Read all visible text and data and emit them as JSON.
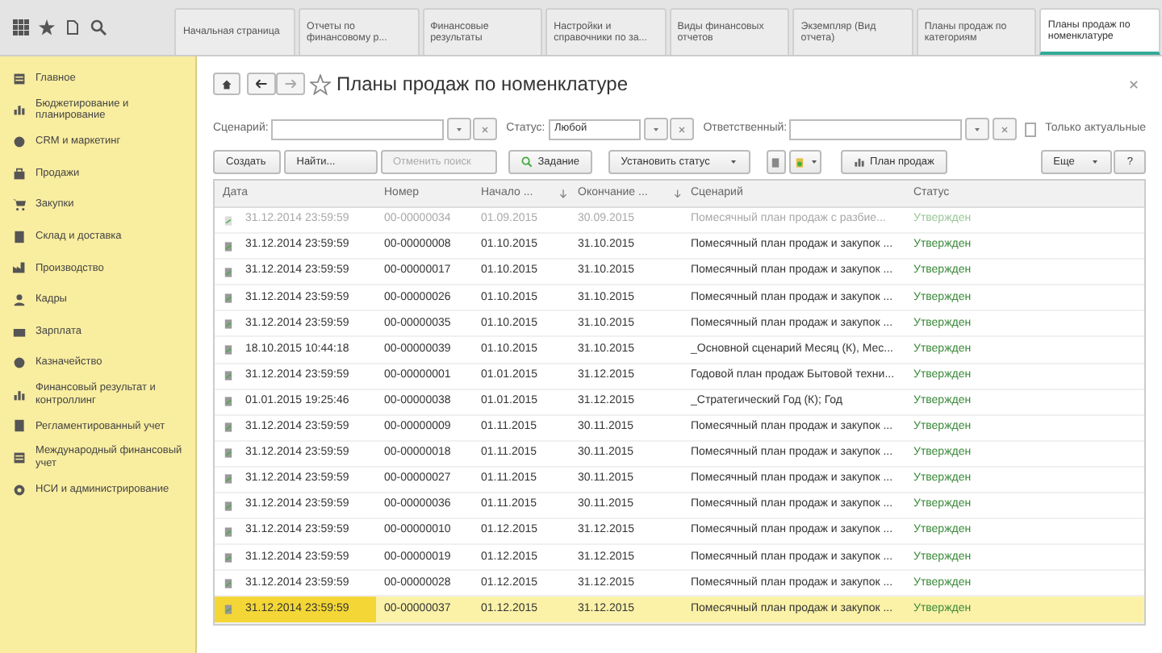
{
  "top_tabs": [
    {
      "label": "Начальная страница",
      "selected": false
    },
    {
      "label": "Отчеты по финансовому р...",
      "selected": false
    },
    {
      "label": "Финансовые результаты",
      "selected": false
    },
    {
      "label": "Настройки и справочники по за...",
      "selected": false
    },
    {
      "label": "Виды финансовых отчетов",
      "selected": false
    },
    {
      "label": "Экземпляр (Вид отчета)",
      "selected": false
    },
    {
      "label": "Планы продаж по категориям",
      "selected": false
    },
    {
      "label": "Планы продаж по номенклатуре",
      "selected": true
    }
  ],
  "sidebar": {
    "items": [
      {
        "label": "Главное"
      },
      {
        "label": "Бюджетирование и планирование"
      },
      {
        "label": "CRM и маркетинг"
      },
      {
        "label": "Продажи"
      },
      {
        "label": "Закупки"
      },
      {
        "label": "Склад и доставка"
      },
      {
        "label": "Производство"
      },
      {
        "label": "Кадры"
      },
      {
        "label": "Зарплата"
      },
      {
        "label": "Казначейство"
      },
      {
        "label": "Финансовый результат и контроллинг"
      },
      {
        "label": "Регламентированный учет"
      },
      {
        "label": "Международный финансовый учет"
      },
      {
        "label": "НСИ и администрирование"
      }
    ]
  },
  "form": {
    "title": "Планы продаж по номенклатуре",
    "filters": [
      {
        "label": "Сценарий:"
      },
      {
        "label": "Статус:",
        "value": "Любой"
      },
      {
        "label": "Ответственный:"
      }
    ],
    "only_actual": {
      "label": "Только актуальные",
      "checked": false
    },
    "toolbar": [
      {
        "label": "Создать",
        "kind": "plain",
        "disabled": false
      },
      {
        "label": "Найти...",
        "kind": "plain",
        "disabled": false
      },
      {
        "label": "Отменить поиск",
        "kind": "plain",
        "disabled": true
      },
      {
        "label": "Задание",
        "kind": "task",
        "disabled": false
      },
      {
        "label": "Установить статус",
        "kind": "dropdown",
        "disabled": false
      },
      {
        "kind": "doc-icon",
        "disabled": false
      },
      {
        "kind": "report-icon",
        "disabled": false
      },
      {
        "label": "План продаж",
        "kind": "plan",
        "disabled": false
      },
      {
        "label": "Еще",
        "kind": "dropdown",
        "disabled": false
      },
      {
        "label": "?",
        "kind": "plain",
        "disabled": false
      }
    ],
    "table": {
      "columns": [
        "Дата",
        "Номер",
        "Начало ...",
        "Окончание ...",
        "Сценарий",
        "Статус"
      ],
      "rows": [
        {
          "cells": [
            "31.12.2014 23:59:59",
            "00-00000034",
            "01.09.2015",
            "30.09.2015",
            "Помесячный план продаж с разбие...",
            "Утвержден"
          ],
          "faded": true,
          "selected": false
        },
        {
          "cells": [
            "31.12.2014 23:59:59",
            "00-00000008",
            "01.10.2015",
            "31.10.2015",
            "Помесячный план продаж и закупок ...",
            "Утвержден"
          ],
          "faded": false,
          "selected": false
        },
        {
          "cells": [
            "31.12.2014 23:59:59",
            "00-00000017",
            "01.10.2015",
            "31.10.2015",
            "Помесячный план продаж и закупок ...",
            "Утвержден"
          ],
          "faded": false,
          "selected": false
        },
        {
          "cells": [
            "31.12.2014 23:59:59",
            "00-00000026",
            "01.10.2015",
            "31.10.2015",
            "Помесячный план продаж и закупок ...",
            "Утвержден"
          ],
          "faded": false,
          "selected": false
        },
        {
          "cells": [
            "31.12.2014 23:59:59",
            "00-00000035",
            "01.10.2015",
            "31.10.2015",
            "Помесячный план продаж и закупок ...",
            "Утвержден"
          ],
          "faded": false,
          "selected": false
        },
        {
          "cells": [
            "18.10.2015 10:44:18",
            "00-00000039",
            "01.10.2015",
            "31.10.2015",
            "_Основной сценарий Месяц (К), Мес...",
            "Утвержден"
          ],
          "faded": false,
          "selected": false
        },
        {
          "cells": [
            "31.12.2014 23:59:59",
            "00-00000001",
            "01.01.2015",
            "31.12.2015",
            "Годовой план продаж Бытовой техни...",
            "Утвержден"
          ],
          "faded": false,
          "selected": false
        },
        {
          "cells": [
            "01.01.2015 19:25:46",
            "00-00000038",
            "01.01.2015",
            "31.12.2015",
            "_Стратегический Год (К); Год",
            "Утвержден"
          ],
          "faded": false,
          "selected": false
        },
        {
          "cells": [
            "31.12.2014 23:59:59",
            "00-00000009",
            "01.11.2015",
            "30.11.2015",
            "Помесячный план продаж и закупок ...",
            "Утвержден"
          ],
          "faded": false,
          "selected": false
        },
        {
          "cells": [
            "31.12.2014 23:59:59",
            "00-00000018",
            "01.11.2015",
            "30.11.2015",
            "Помесячный план продаж и закупок ...",
            "Утвержден"
          ],
          "faded": false,
          "selected": false
        },
        {
          "cells": [
            "31.12.2014 23:59:59",
            "00-00000027",
            "01.11.2015",
            "30.11.2015",
            "Помесячный план продаж и закупок ...",
            "Утвержден"
          ],
          "faded": false,
          "selected": false
        },
        {
          "cells": [
            "31.12.2014 23:59:59",
            "00-00000036",
            "01.11.2015",
            "30.11.2015",
            "Помесячный план продаж и закупок ...",
            "Утвержден"
          ],
          "faded": false,
          "selected": false
        },
        {
          "cells": [
            "31.12.2014 23:59:59",
            "00-00000010",
            "01.12.2015",
            "31.12.2015",
            "Помесячный план продаж и закупок ...",
            "Утвержден"
          ],
          "faded": false,
          "selected": false
        },
        {
          "cells": [
            "31.12.2014 23:59:59",
            "00-00000019",
            "01.12.2015",
            "31.12.2015",
            "Помесячный план продаж и закупок ...",
            "Утвержден"
          ],
          "faded": false,
          "selected": false
        },
        {
          "cells": [
            "31.12.2014 23:59:59",
            "00-00000028",
            "01.12.2015",
            "31.12.2015",
            "Помесячный план продаж и закупок ...",
            "Утвержден"
          ],
          "faded": false,
          "selected": false
        },
        {
          "cells": [
            "31.12.2014 23:59:59",
            "00-00000037",
            "01.12.2015",
            "31.12.2015",
            "Помесячный план продаж и закупок ...",
            "Утвержден"
          ],
          "faded": false,
          "selected": true
        }
      ]
    }
  }
}
